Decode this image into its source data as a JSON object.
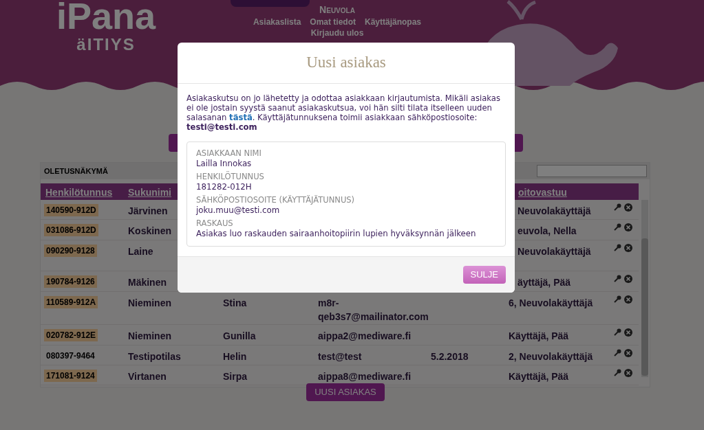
{
  "header": {
    "logo": "iPana",
    "logo_sub": "äITIYS",
    "section": "Neuvola",
    "nav": [
      "Asiakaslista",
      "Omat tiedot",
      "Käyttäjänopas",
      "Kirjaudu ulos"
    ]
  },
  "table": {
    "view_label": "OLETUSNÄKYMÄ",
    "columns": [
      "Henkilötunnus",
      "Sukunimi",
      "oitovastuu"
    ],
    "rows": [
      {
        "id": "140590-912D",
        "highlighted": true,
        "surname": "Järvinen",
        "care": "Neuvolakäyttäjä"
      },
      {
        "id": "031086-912D",
        "highlighted": true,
        "surname": "Koskinen",
        "care": "euvola, Nella"
      },
      {
        "id": "090290-9128",
        "highlighted": true,
        "surname": "Laine",
        "care": "Neuvolakäyttäjä"
      },
      {
        "id": "190784-9126",
        "highlighted": true,
        "surname": "Mäkinen",
        "care": "äyttäjä, Pää"
      },
      {
        "id": "110589-912A",
        "highlighted": true,
        "surname": "Nieminen",
        "first_name": "Stina",
        "email": "m8r-qeb3s7@mailinator.com",
        "care": "6, Neuvolakäyttäjä"
      },
      {
        "id": "020782-912E",
        "highlighted": true,
        "surname": "Nieminen",
        "first_name": "Gunilla",
        "email": "aippa2@mediware.fi",
        "care": "Käyttäjä, Pää"
      },
      {
        "id": "080397-9464",
        "highlighted": false,
        "surname": "Testipotilas",
        "first_name": "Helin",
        "email": "test@test",
        "date": "5.2.2018",
        "care": "2, Neuvolakäyttäjä"
      },
      {
        "id": "171081-9124",
        "highlighted": true,
        "surname": "Virtanen",
        "first_name": "Sirpa",
        "email": "aippa8@mediware.fi",
        "care": "Käyttäjä, Pää"
      }
    ]
  },
  "new_button": "UUSI ASIAKAS",
  "modal": {
    "title": "Uusi asiakas",
    "intro_before": "Asiakaskutsu on jo lähetetty ja odottaa asiakkaan kirjautumista. Mikäli asiakas ei ole jostain syystä saanut asiakaskutsua, voi hän silti tilata itselleen uuden salasanan ",
    "link": "tästä",
    "intro_after": ". Käyttäjätunnuksena toimii asiakkaan sähköpostiosoite: **testi@testi.com**",
    "fields": [
      {
        "label": "ASIAKKAAN NIMI",
        "value": "Lailla Innokas"
      },
      {
        "label": "HENKILÖTUNNUS",
        "value": "181282-012H"
      },
      {
        "label": "SÄHKÖPOSTIOSOITE (KÄYTTÄJÄTUNNUS)",
        "value": "joku.muu@testi.com"
      },
      {
        "label": "RASKAUS",
        "value": "Asiakas luo raskauden sairaanhoitopiirin lupien hyväksynnän jälkeen"
      }
    ],
    "close_button": "SULJE"
  }
}
